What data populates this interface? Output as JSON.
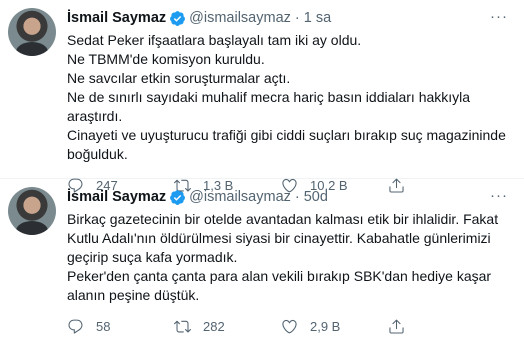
{
  "tweets": [
    {
      "name": "İsmail Saymaz",
      "handle": "@ismailsaymaz",
      "dot": "·",
      "time": "1 sa",
      "lines": [
        "Sedat Peker ifşaatlara başlayalı tam iki ay oldu.",
        "Ne TBMM'de komisyon kuruldu.",
        "Ne savcılar etkin soruşturmalar açtı.",
        "Ne de sınırlı sayıdaki muhalif mecra hariç basın iddiaları hakkıyla araştırdı.",
        "Cinayeti ve uyuşturucu trafiği gibi ciddi suçları bırakıp suç magazininde boğulduk."
      ],
      "replies": "247",
      "retweets": "1,3 B",
      "likes": "10,2 B"
    },
    {
      "name": "İsmail Saymaz",
      "handle": "@ismailsaymaz",
      "dot": "·",
      "time": "50d",
      "lines": [
        "Birkaç gazetecinin bir otelde avantadan kalması etik bir ihlalidir. Fakat Kutlu Adalı'nın öldürülmesi siyasi bir cinayettir. Kabahatle günlerimizi geçirip suça kafa yormadık.",
        "Peker'den çanta çanta para alan vekili bırakıp SBK'dan hediye kaşar alanın peşine düştük."
      ],
      "replies": "58",
      "retweets": "282",
      "likes": "2,9 B"
    }
  ],
  "icons": {
    "verified": "verified-badge-icon",
    "more": "more-icon",
    "reply": "reply-icon",
    "retweet": "retweet-icon",
    "like": "heart-icon",
    "share": "share-icon"
  },
  "colors": {
    "verified": "#1d9bf0",
    "secondary_text": "#536471",
    "primary_text": "#0f1419"
  }
}
